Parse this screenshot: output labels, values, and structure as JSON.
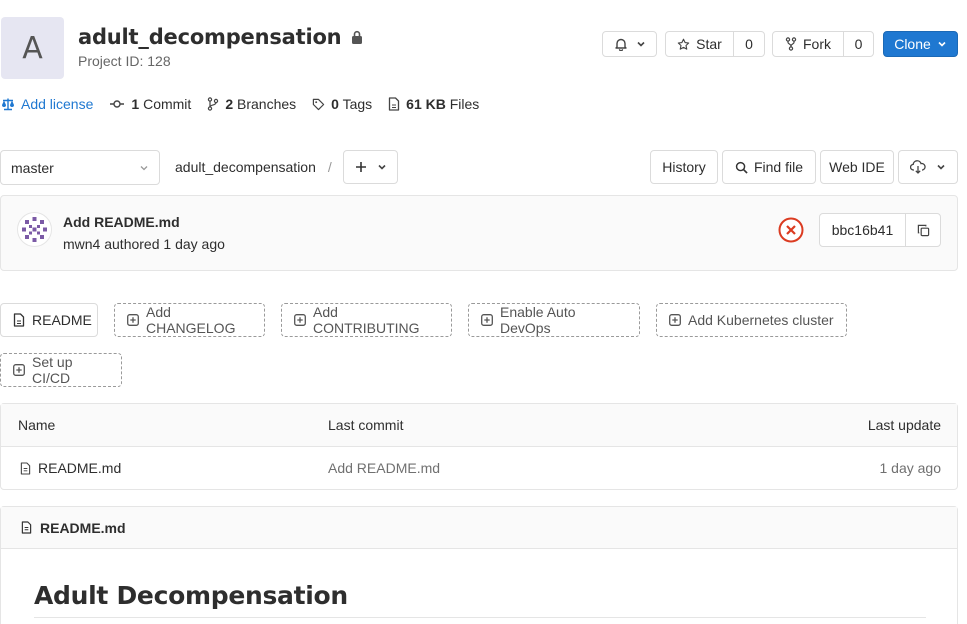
{
  "project": {
    "avatar_letter": "A",
    "name": "adult_decompensation",
    "id_text": "Project ID: 128"
  },
  "header_actions": {
    "star_label": "Star",
    "star_count": "0",
    "fork_label": "Fork",
    "fork_count": "0",
    "clone_label": "Clone"
  },
  "stats": {
    "license": "Add license",
    "commits_num": "1",
    "commits_label": "Commit",
    "branches_num": "2",
    "branches_label": "Branches",
    "tags_num": "0",
    "tags_label": "Tags",
    "files_num": "61 KB",
    "files_label": "Files"
  },
  "tree": {
    "branch": "master",
    "path": "adult_decompensation",
    "separator": "/",
    "history": "History",
    "find_file": "Find file",
    "web_ide": "Web IDE"
  },
  "last_commit": {
    "title": "Add README.md",
    "meta": "mwn4 authored 1 day ago",
    "status": "failed",
    "sha": "bbc16b41"
  },
  "quick_actions": {
    "readme": "README",
    "changelog": "Add CHANGELOG",
    "contributing": "Add CONTRIBUTING",
    "auto_devops": "Enable Auto DevOps",
    "kubernetes": "Add Kubernetes cluster",
    "cicd": "Set up CI/CD"
  },
  "files_table": {
    "headers": {
      "name": "Name",
      "last_commit": "Last commit",
      "last_update": "Last update"
    },
    "rows": [
      {
        "name": "README.md",
        "last_commit": "Add README.md",
        "last_update": "1 day ago"
      }
    ]
  },
  "readme": {
    "filename": "README.md",
    "heading": "Adult Decompensation"
  },
  "colors": {
    "primary": "#1f78d1",
    "danger": "#db3b21",
    "border": "#dbdbdb"
  }
}
